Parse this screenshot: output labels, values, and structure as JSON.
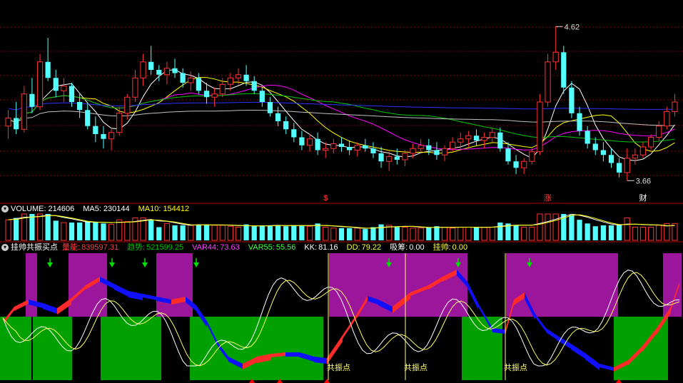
{
  "colors": {
    "background": "#000000",
    "up": "#ff3232",
    "down": "#54ffff",
    "grid": "#8b0000",
    "divider": "#b00000",
    "ma5": "#ffffff",
    "ma10": "#ffff00",
    "ma20": "#ff00ff",
    "ma60": "#00c800",
    "ma120": "#c0c0c0",
    "ma250": "#3030ff",
    "zone_purple": "#9b169b",
    "zone_green": "#00a000",
    "ribbon_up": "#ff2a2a",
    "ribbon_down": "#1010ff",
    "resonance_line": "#ffff66",
    "signal_arrow": "#00e000",
    "bottom_marker": "#ff0000"
  },
  "price_panel": {
    "high_label": "4.62",
    "low_label": "3.66",
    "event_markers": [
      {
        "label": "$",
        "color": "#ff3b3b"
      },
      {
        "label": "涨",
        "color": "#ff4040"
      },
      {
        "label": "财",
        "color": "#ffffff"
      }
    ]
  },
  "volume_panel": {
    "toggle_icon": "chevron-down-icon",
    "title": "VOLUME:",
    "value": "214606",
    "ma5_label": "MA5:",
    "ma5_value": "230144",
    "ma10_label": "MA10:",
    "ma10_value": "154412"
  },
  "indicator_panel": {
    "toggle_icon": "chevron-down-icon",
    "title": "挂帅共振买点",
    "fields": [
      {
        "label": "量能:",
        "value": "839597.31",
        "color": "#ff4040"
      },
      {
        "label": "趋势:",
        "value": "521599.25",
        "color": "#00c000"
      },
      {
        "label": "VAR44:",
        "value": "73.63",
        "color": "#ff40ff"
      },
      {
        "label": "VAR55:",
        "value": "55.56",
        "color": "#40ff40"
      },
      {
        "label": "KK:",
        "value": "81.16",
        "color": "#ffffff"
      },
      {
        "label": "DD:",
        "value": "79.22",
        "color": "#ffff40"
      },
      {
        "label": "吸筹:",
        "value": "0.00",
        "color": "#ffffff"
      },
      {
        "label": "挂帅:",
        "value": "0.00",
        "color": "#ffff40"
      }
    ],
    "resonance_label": "共振点"
  },
  "chart_data": [
    {
      "type": "candlestick",
      "title": "",
      "price_range": [
        3.55,
        4.75
      ],
      "high": 4.62,
      "low": 3.66,
      "moving_averages": [
        "MA5",
        "MA10",
        "MA20",
        "MA60",
        "MA120",
        "MA250"
      ],
      "candles": [
        [
          4.0,
          4.1,
          3.92,
          4.05
        ],
        [
          4.05,
          4.15,
          3.95,
          3.98
        ],
        [
          3.98,
          4.25,
          3.96,
          4.2
        ],
        [
          4.2,
          4.3,
          4.08,
          4.12
        ],
        [
          4.12,
          4.45,
          4.1,
          4.4
        ],
        [
          4.4,
          4.55,
          4.28,
          4.3
        ],
        [
          4.3,
          4.35,
          4.18,
          4.22
        ],
        [
          4.22,
          4.3,
          4.15,
          4.25
        ],
        [
          4.25,
          4.27,
          4.12,
          4.15
        ],
        [
          4.15,
          4.2,
          4.05,
          4.1
        ],
        [
          4.1,
          4.14,
          3.98,
          4.0
        ],
        [
          4.0,
          4.06,
          3.9,
          3.95
        ],
        [
          3.95,
          4.0,
          3.86,
          3.92
        ],
        [
          3.92,
          3.98,
          3.85,
          3.96
        ],
        [
          3.96,
          4.12,
          3.94,
          4.08
        ],
        [
          4.08,
          4.2,
          4.04,
          4.18
        ],
        [
          4.18,
          4.35,
          4.15,
          4.3
        ],
        [
          4.3,
          4.45,
          4.25,
          4.4
        ],
        [
          4.4,
          4.5,
          4.32,
          4.35
        ],
        [
          4.35,
          4.38,
          4.28,
          4.32
        ],
        [
          4.32,
          4.4,
          4.26,
          4.36
        ],
        [
          4.36,
          4.42,
          4.3,
          4.33
        ],
        [
          4.33,
          4.36,
          4.24,
          4.27
        ],
        [
          4.27,
          4.34,
          4.22,
          4.3
        ],
        [
          4.3,
          4.33,
          4.2,
          4.22
        ],
        [
          4.22,
          4.27,
          4.14,
          4.18
        ],
        [
          4.18,
          4.24,
          4.12,
          4.2
        ],
        [
          4.2,
          4.3,
          4.18,
          4.26
        ],
        [
          4.26,
          4.33,
          4.22,
          4.3
        ],
        [
          4.3,
          4.36,
          4.26,
          4.32
        ],
        [
          4.32,
          4.38,
          4.25,
          4.28
        ],
        [
          4.28,
          4.31,
          4.2,
          4.22
        ],
        [
          4.22,
          4.24,
          4.12,
          4.15
        ],
        [
          4.15,
          4.18,
          4.06,
          4.08
        ],
        [
          4.08,
          4.12,
          4.0,
          4.03
        ],
        [
          4.03,
          4.06,
          3.95,
          3.98
        ],
        [
          3.98,
          4.02,
          3.9,
          3.93
        ],
        [
          3.93,
          3.97,
          3.85,
          3.88
        ],
        [
          3.88,
          3.95,
          3.84,
          3.92
        ],
        [
          3.92,
          3.96,
          3.82,
          3.85
        ],
        [
          3.85,
          3.9,
          3.8,
          3.86
        ],
        [
          3.86,
          3.92,
          3.83,
          3.89
        ],
        [
          3.89,
          3.93,
          3.84,
          3.87
        ],
        [
          3.87,
          3.91,
          3.82,
          3.85
        ],
        [
          3.85,
          3.9,
          3.81,
          3.88
        ],
        [
          3.88,
          3.92,
          3.84,
          3.86
        ],
        [
          3.86,
          3.9,
          3.8,
          3.83
        ],
        [
          3.83,
          3.87,
          3.74,
          3.78
        ],
        [
          3.78,
          3.84,
          3.72,
          3.81
        ],
        [
          3.81,
          3.86,
          3.76,
          3.79
        ],
        [
          3.79,
          3.85,
          3.75,
          3.83
        ],
        [
          3.83,
          3.89,
          3.8,
          3.86
        ],
        [
          3.86,
          3.92,
          3.83,
          3.88
        ],
        [
          3.88,
          3.92,
          3.82,
          3.85
        ],
        [
          3.85,
          3.9,
          3.79,
          3.82
        ],
        [
          3.82,
          3.88,
          3.78,
          3.86
        ],
        [
          3.86,
          3.93,
          3.84,
          3.9
        ],
        [
          3.9,
          3.96,
          3.86,
          3.92
        ],
        [
          3.92,
          3.97,
          3.87,
          3.94
        ],
        [
          3.94,
          3.98,
          3.88,
          3.91
        ],
        [
          3.91,
          3.96,
          3.86,
          3.93
        ],
        [
          3.93,
          3.99,
          3.89,
          3.96
        ],
        [
          3.96,
          3.99,
          3.84,
          3.86
        ],
        [
          3.86,
          3.9,
          3.76,
          3.78
        ],
        [
          3.78,
          3.82,
          3.7,
          3.74
        ],
        [
          3.74,
          3.8,
          3.7,
          3.78
        ],
        [
          3.78,
          3.86,
          3.76,
          3.84
        ],
        [
          3.84,
          4.2,
          3.82,
          4.15
        ],
        [
          4.15,
          4.45,
          4.12,
          4.4
        ],
        [
          4.4,
          4.62,
          4.35,
          4.46
        ],
        [
          4.46,
          4.5,
          4.2,
          4.24
        ],
        [
          4.24,
          4.28,
          4.05,
          4.08
        ],
        [
          4.08,
          4.12,
          3.94,
          3.97
        ],
        [
          3.97,
          4.0,
          3.86,
          3.89
        ],
        [
          3.89,
          3.93,
          3.82,
          3.85
        ],
        [
          3.85,
          3.9,
          3.78,
          3.82
        ],
        [
          3.82,
          3.86,
          3.74,
          3.77
        ],
        [
          3.77,
          3.8,
          3.68,
          3.71
        ],
        [
          3.71,
          3.86,
          3.66,
          3.8
        ],
        [
          3.8,
          3.86,
          3.76,
          3.82
        ],
        [
          3.82,
          3.9,
          3.8,
          3.87
        ],
        [
          3.87,
          3.95,
          3.85,
          3.93
        ],
        [
          3.93,
          4.03,
          3.91,
          4.0
        ],
        [
          4.0,
          4.12,
          3.98,
          4.09
        ],
        [
          4.09,
          4.2,
          4.06,
          4.15
        ]
      ]
    },
    {
      "type": "bar",
      "title": "VOLUME",
      "values": [
        214606
      ],
      "ma5": 230144,
      "ma10": 154412
    },
    {
      "type": "line",
      "title": "挂帅共振买点",
      "series": [
        {
          "name": "KK",
          "value": 81.16
        },
        {
          "name": "DD",
          "value": 79.22
        },
        {
          "name": "VAR44",
          "value": 73.63
        },
        {
          "name": "VAR55",
          "value": 55.56
        }
      ],
      "annotations": [
        "共振点",
        "共振点",
        "共振点",
        "共振点"
      ]
    }
  ]
}
